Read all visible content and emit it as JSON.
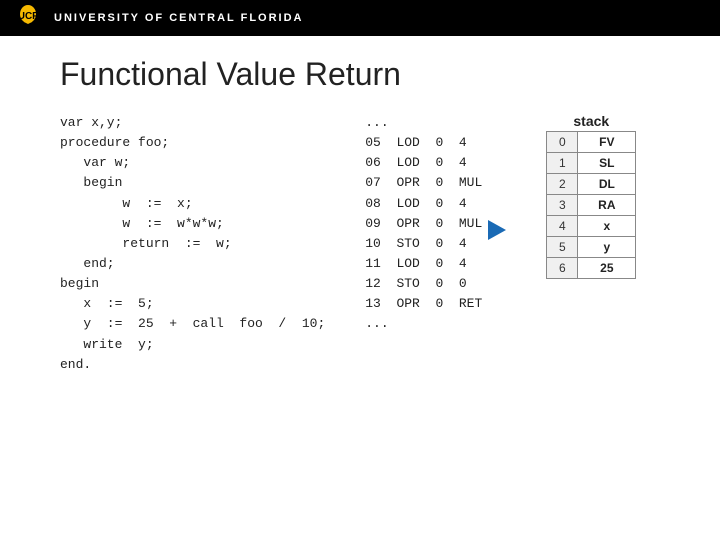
{
  "header": {
    "university_name": "UNIVERSITY OF CENTRAL FLORIDA"
  },
  "page": {
    "title": "Functional Value Return"
  },
  "code": {
    "lines": [
      "var x,y;",
      "procedure foo;",
      "   var w;",
      "   begin",
      "        w  :=  x;",
      "        w  :=  w*w*w;",
      "        return  :=  w;",
      "   end;",
      "begin",
      "   x  :=  5;",
      "   y  :=  25  +  call  foo  /  10;",
      "   write  y;",
      "end."
    ]
  },
  "bytecode": {
    "prefix": "...",
    "lines": [
      "05  LOD  0  4",
      "06  LOD  0  4",
      "07  OPR  0  MUL",
      "08  LOD  0  4",
      "09  OPR  0  MUL",
      "10  STO  0  4",
      "11  LOD  0  4",
      "12  STO  0  0",
      "13  OPR  0  RET"
    ],
    "suffix": "..."
  },
  "stack": {
    "title": "stack",
    "rows": [
      {
        "index": "0",
        "value": "FV"
      },
      {
        "index": "1",
        "value": "SL"
      },
      {
        "index": "2",
        "value": "DL"
      },
      {
        "index": "3",
        "value": "RA"
      },
      {
        "index": "4",
        "value": "x"
      },
      {
        "index": "5",
        "value": "y"
      },
      {
        "index": "6",
        "value": "25"
      }
    ]
  }
}
